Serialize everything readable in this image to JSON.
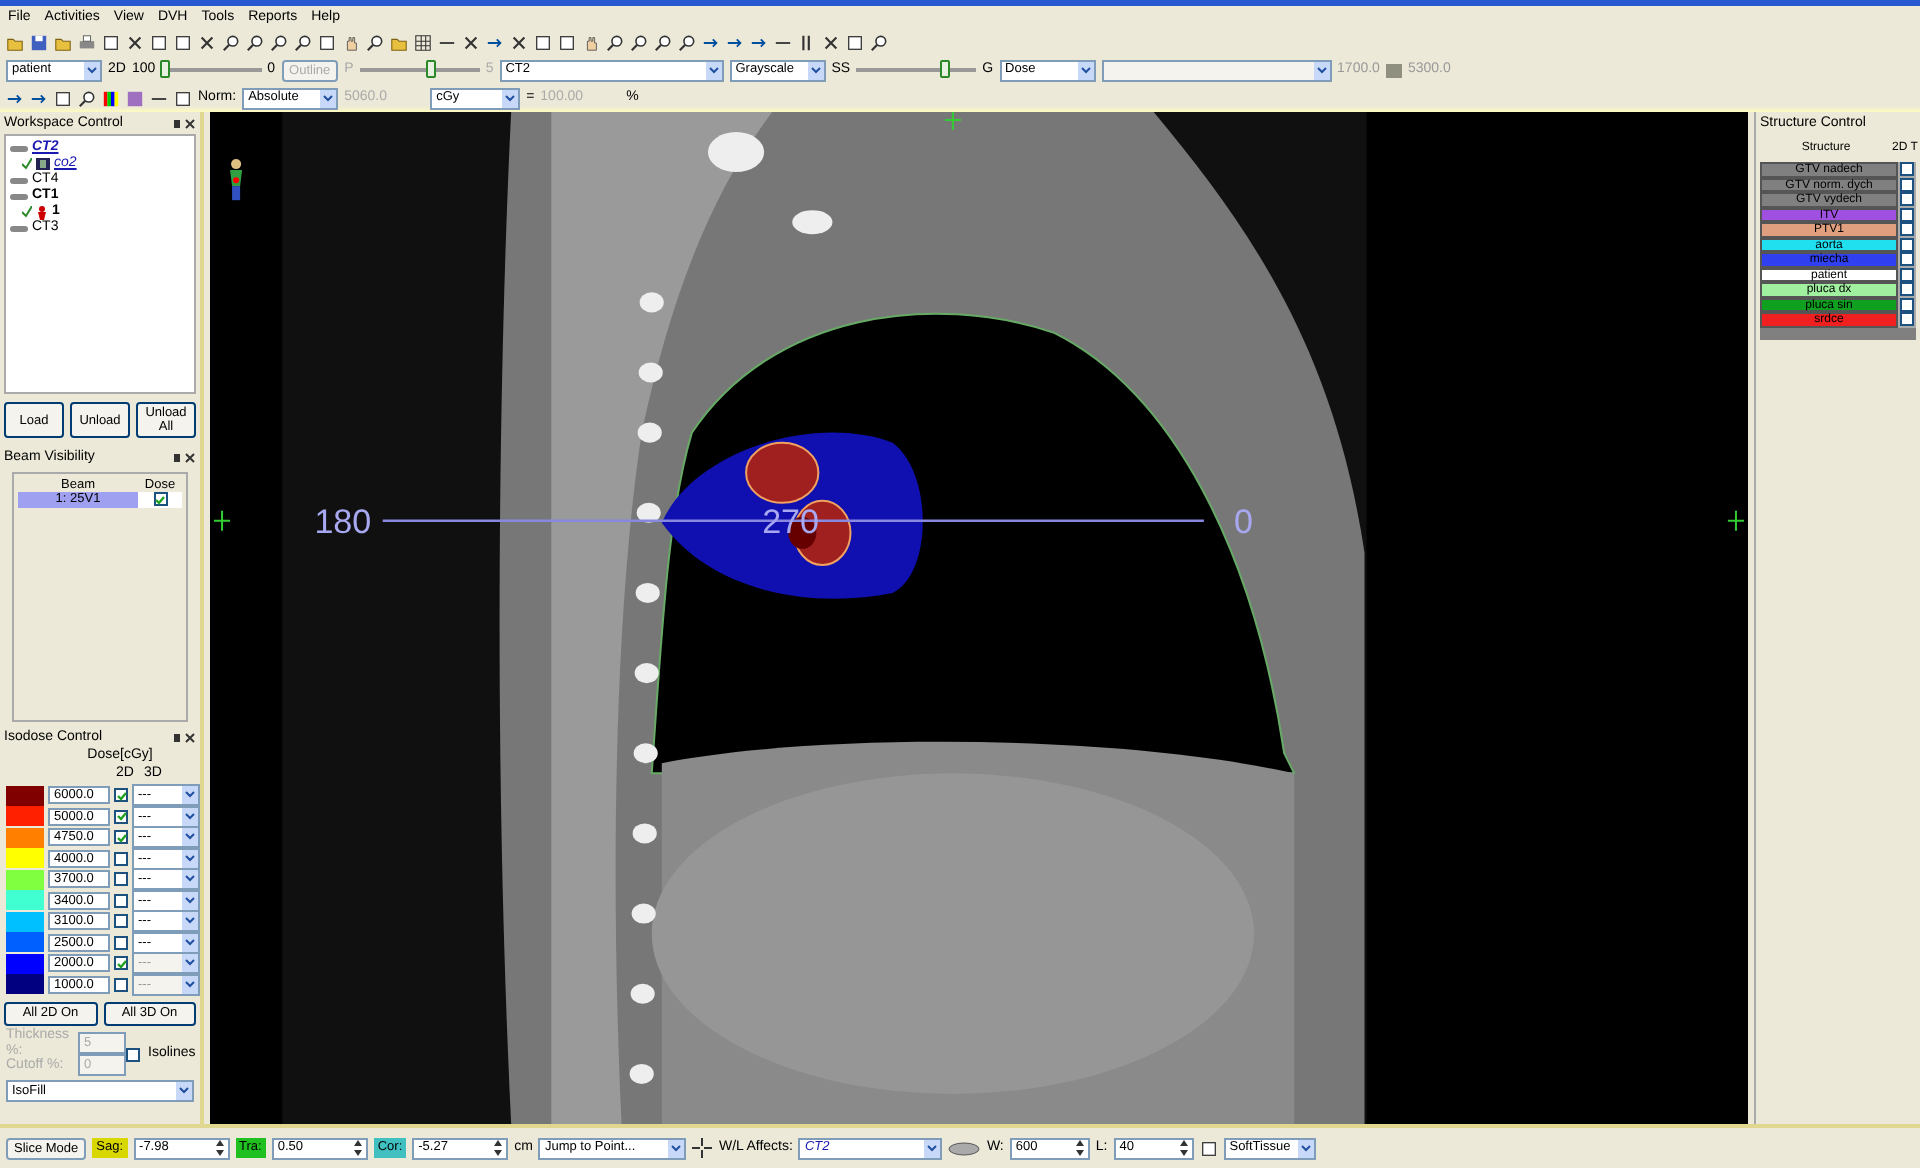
{
  "menu": [
    "File",
    "Activities",
    "View",
    "DVH",
    "Tools",
    "Reports",
    "Help"
  ],
  "view_controls": {
    "dataset_select": "patient",
    "dimension": "2D",
    "left_value": "100",
    "slider_1": {
      "level": 0.05
    },
    "right_value": "0",
    "outline_button": {
      "label": "Outline",
      "disabled": true
    },
    "p_label": "P",
    "slider_2": {
      "level": 0.6
    },
    "p_value": "5",
    "image_select": "CT2",
    "colormap_select": "Grayscale",
    "ss_label": "SS",
    "slider_3": {
      "level": 0.75
    },
    "g_label": "G",
    "dose_select": "Dose",
    "range_min": "1700.0",
    "range_max": "5300.0"
  },
  "norm_controls": {
    "label": "Norm:",
    "mode_select": "Absolute",
    "value": {
      "text": "5060.0",
      "disabled": true
    },
    "unit_select": "cGy",
    "equals": "=",
    "percent": {
      "text": "100.00",
      "disabled": true
    },
    "percent_sign": "%"
  },
  "workspace": {
    "title": "Workspace Control",
    "items": [
      {
        "label": "CT2",
        "kind": "active_image",
        "checked": false
      },
      {
        "label": "co2",
        "kind": "plan",
        "checked": true
      },
      {
        "label": "CT4",
        "kind": "image",
        "checked": false
      },
      {
        "label": "CT1",
        "kind": "open_image",
        "checked": false
      },
      {
        "label": "1",
        "kind": "patient",
        "checked": true
      },
      {
        "label": "CT3",
        "kind": "image",
        "checked": false
      }
    ],
    "buttons": [
      "Load",
      "Unload",
      "Unload All"
    ]
  },
  "beam_visibility": {
    "title": "Beam Visibility",
    "columns": [
      "Beam",
      "Dose"
    ],
    "rows": [
      {
        "beam": "1: 25V1",
        "selected": true,
        "dose": true
      }
    ]
  },
  "isodose": {
    "title": "Isodose Control",
    "header": "Dose[cGy]",
    "col_2d": "2D",
    "col_3d": "3D",
    "levels": [
      {
        "color": "#800000",
        "value": "6000.0",
        "checked": true,
        "mode_3d": "---",
        "disabled_3d": false
      },
      {
        "color": "#ff2000",
        "value": "5000.0",
        "checked": true,
        "mode_3d": "---",
        "disabled_3d": false
      },
      {
        "color": "#ff8000",
        "value": "4750.0",
        "checked": true,
        "mode_3d": "---",
        "disabled_3d": false
      },
      {
        "color": "#ffff00",
        "value": "4000.0",
        "checked": false,
        "mode_3d": "---",
        "disabled_3d": false
      },
      {
        "color": "#80ff40",
        "value": "3700.0",
        "checked": false,
        "mode_3d": "---",
        "disabled_3d": false
      },
      {
        "color": "#40ffd0",
        "value": "3400.0",
        "checked": false,
        "mode_3d": "---",
        "disabled_3d": false
      },
      {
        "color": "#00c0ff",
        "value": "3100.0",
        "checked": false,
        "mode_3d": "---",
        "disabled_3d": false
      },
      {
        "color": "#0060ff",
        "value": "2500.0",
        "checked": false,
        "mode_3d": "---",
        "disabled_3d": false
      },
      {
        "color": "#0000ff",
        "value": "2000.0",
        "checked": true,
        "mode_3d": "---",
        "disabled_3d": true
      },
      {
        "color": "#000080",
        "value": "1000.0",
        "checked": false,
        "mode_3d": "---",
        "disabled_3d": true
      }
    ],
    "buttons": [
      "All 2D On",
      "All 3D On"
    ],
    "thickness": {
      "label": "Thickness %:",
      "value": "5",
      "disabled": true
    },
    "cutoff": {
      "label": "Cutoff %:",
      "value": "0",
      "disabled": true
    },
    "isolines": {
      "label": "Isolines",
      "checked": false
    },
    "display_select": "IsoFill"
  },
  "viewer": {
    "angle_labels": [
      "180",
      "270",
      "0"
    ]
  },
  "structures": {
    "title": "Structure Control",
    "columns": [
      "Structure",
      "2D T"
    ],
    "rows": [
      {
        "name": "GTV nadech",
        "color": "#808080",
        "checked": false
      },
      {
        "name": "GTV norm. dych",
        "color": "#808080",
        "checked": false
      },
      {
        "name": "GTV vydech",
        "color": "#808080",
        "checked": false
      },
      {
        "name": "ITV",
        "color": "#a050e0",
        "checked": false
      },
      {
        "name": "PTV1",
        "color": "#e0a080",
        "checked": false
      },
      {
        "name": "aorta",
        "color": "#20e0f0",
        "checked": false
      },
      {
        "name": "miecha",
        "color": "#3040f0",
        "checked": false
      },
      {
        "name": "patient",
        "color": "#ffffff",
        "checked": false
      },
      {
        "name": "pluca dx",
        "color": "#a0f0a0",
        "checked": false
      },
      {
        "name": "pluca sin",
        "color": "#10a020",
        "checked": false
      },
      {
        "name": "srdce",
        "color": "#f02020",
        "checked": false
      }
    ]
  },
  "status_bar": {
    "slice_mode": "Slice Mode",
    "coords": [
      {
        "label": "Sag:",
        "value": "-7.98",
        "color": "#d8d800"
      },
      {
        "label": "Tra:",
        "value": "0.50",
        "color": "#20c020"
      },
      {
        "label": "Cor:",
        "value": "-5.27",
        "color": "#40c0c0"
      }
    ],
    "unit": "cm",
    "jump_select": "Jump to Point...",
    "wl_label": "W/L Affects:",
    "wl_select": "CT2",
    "w_label": "W:",
    "w_value": "600",
    "l_label": "L:",
    "l_value": "40",
    "preset_select": "SoftTissue"
  }
}
